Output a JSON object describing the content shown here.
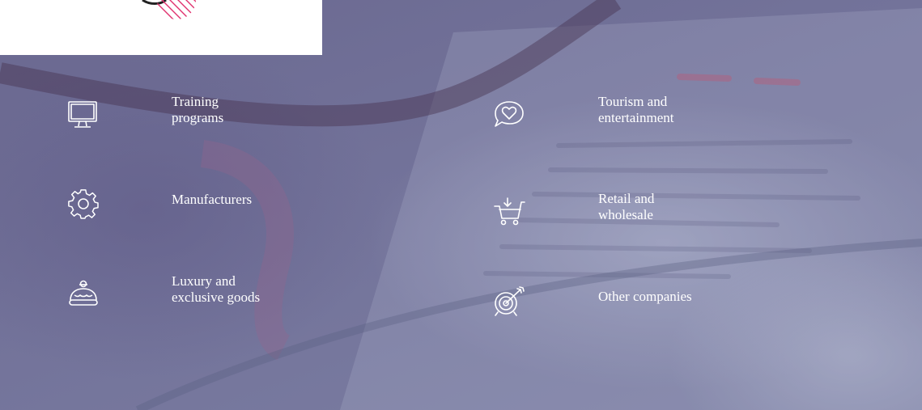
{
  "industries": [
    {
      "icon": "monitor-icon",
      "lines": [
        "Training",
        "programs"
      ]
    },
    {
      "icon": "gear-icon",
      "lines": [
        "Manufacturers"
      ]
    },
    {
      "icon": "crown-icon",
      "lines": [
        "Luxury and",
        "exclusive goods"
      ]
    },
    {
      "icon": "heart-speech-bubble-icon",
      "lines": [
        "Tourism and",
        "entertainment"
      ]
    },
    {
      "icon": "shopping-cart-icon",
      "lines": [
        "Retail and",
        "wholesale"
      ]
    },
    {
      "icon": "target-arrow-icon",
      "lines": [
        "Other companies"
      ]
    }
  ],
  "colors": {
    "text": "#ffffff",
    "overlay": "#6f6f95",
    "logo_accent": "#e0336f"
  }
}
